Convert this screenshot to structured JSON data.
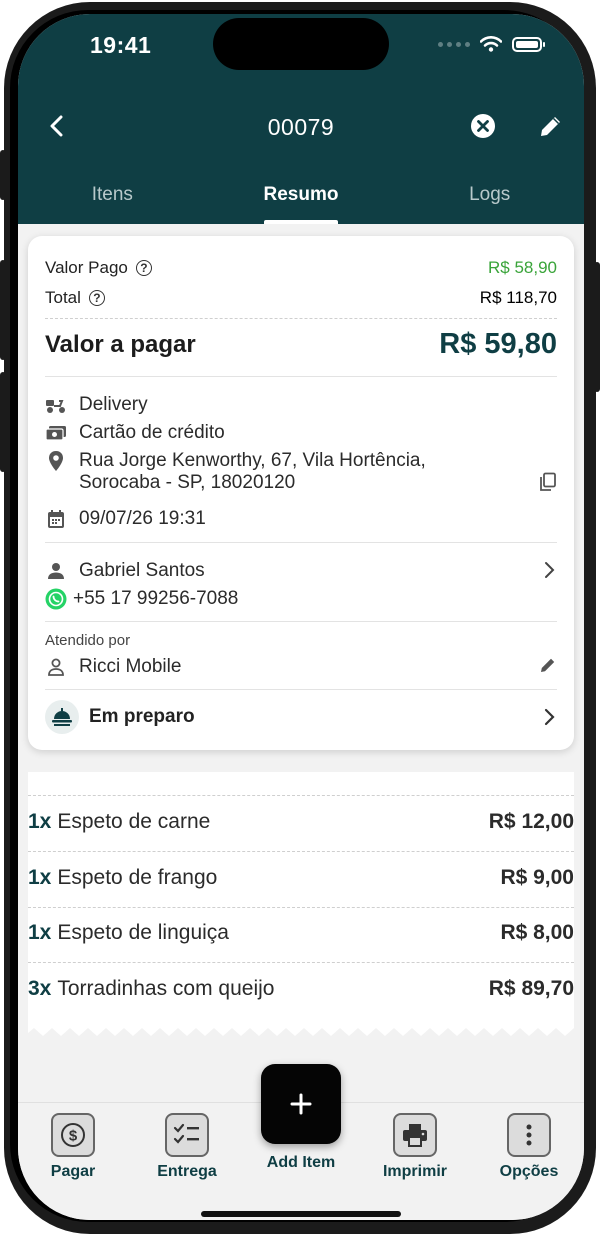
{
  "status": {
    "time": "19:41"
  },
  "header": {
    "order_number": "00079"
  },
  "tabs": [
    "Itens",
    "Resumo",
    "Logs"
  ],
  "summary": {
    "paid_label": "Valor Pago",
    "paid_value": "R$ 58,90",
    "total_label": "Total",
    "total_value": "R$ 118,70",
    "due_label": "Valor a pagar",
    "due_value": "R$ 59,80",
    "delivery": "Delivery",
    "payment": "Cartão de crédito",
    "address_line1": "Rua Jorge Kenworthy, 67, Vila Hortência,",
    "address_line2": "Sorocaba - SP, 18020120",
    "datetime": "09/07/26 19:31",
    "customer_name": "Gabriel Santos",
    "customer_phone": "+55 17 99256-7088",
    "served_by_label": "Atendido por",
    "served_by": "Ricci Mobile",
    "order_status": "Em preparo"
  },
  "items": [
    {
      "qty": "1x",
      "name": "Espeto de carne",
      "price": "R$ 12,00"
    },
    {
      "qty": "1x",
      "name": "Espeto de frango",
      "price": "R$ 9,00"
    },
    {
      "qty": "1x",
      "name": "Espeto de linguiça",
      "price": "R$ 8,00"
    },
    {
      "qty": "3x",
      "name": "Torradinhas com queijo",
      "price": "R$ 89,70"
    }
  ],
  "bottom_nav": {
    "pay": "Pagar",
    "delivery": "Entrega",
    "add_item": "Add Item",
    "print": "Imprimir",
    "options": "Opções"
  },
  "colors": {
    "primary": "#0f3e44",
    "paid_green": "#3aa43a",
    "whatsapp": "#25d366"
  }
}
